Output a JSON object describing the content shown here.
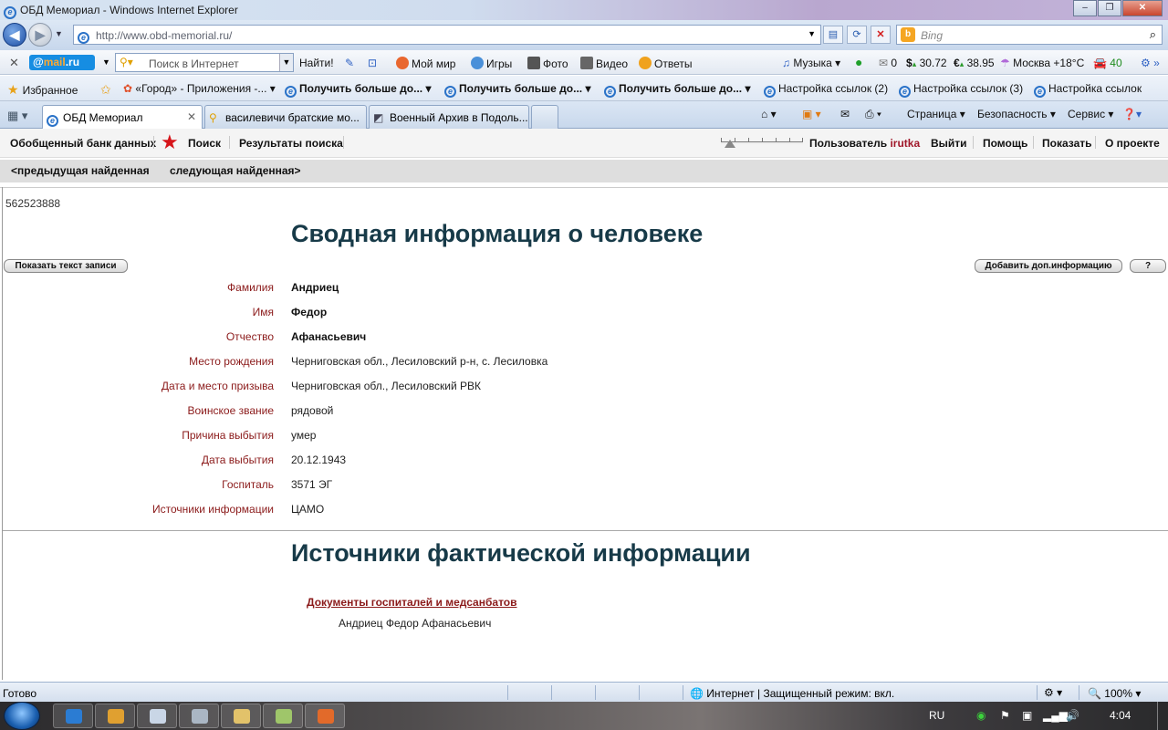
{
  "window": {
    "title": "ОБД Мемориал - Windows Internet Explorer"
  },
  "address": {
    "url": "http://www.obd-memorial.ru/",
    "search_placeholder": "Bing"
  },
  "mailru": {
    "logo": "@mail.ru",
    "search_placeholder": "Поиск в Интернет",
    "find": "Найти!",
    "items": [
      "Мой мир",
      "Игры",
      "Фото",
      "Видео",
      "Ответы"
    ],
    "music": "Музыка",
    "mail_count": "0",
    "usd": "30.72",
    "eur": "38.95",
    "weather": "Москва +18°C",
    "traffic": "40"
  },
  "favorites": {
    "label": "Избранное",
    "items": [
      "«Город» - Приложения -...",
      "Получить больше до...",
      "Получить больше до...",
      "Получить больше до...",
      "Настройка ссылок (2)",
      "Настройка ссылок (3)",
      "Настройка ссылок"
    ]
  },
  "tabs": [
    {
      "label": "ОБД Мемориал"
    },
    {
      "label": "василевичи братские мо..."
    },
    {
      "label": "Военный Архив в Подоль..."
    }
  ],
  "commands": {
    "page": "Страница",
    "security": "Безопасность",
    "service": "Сервис"
  },
  "site_nav": {
    "bank": "Обобщенный банк данных",
    "search": "Поиск",
    "results": "Результаты поиска",
    "user_label": "Пользователь",
    "user_name": "irutka",
    "logout": "Выйти",
    "help": "Помощь",
    "show": "Показать",
    "about": "О проекте"
  },
  "record_nav": {
    "prev": "<предыдущая найденная",
    "next": "следующая найденная>"
  },
  "record": {
    "id": "562523888",
    "title": "Сводная информация о человеке",
    "show_text_btn": "Показать текст записи",
    "add_info_btn": "Добавить доп.информацию",
    "help_btn": "?",
    "fields": [
      {
        "label": "Фамилия",
        "value": "Андриец",
        "bold": true
      },
      {
        "label": "Имя",
        "value": "Федор",
        "bold": true
      },
      {
        "label": "Отчество",
        "value": "Афанасьевич",
        "bold": true
      },
      {
        "label": "Место рождения",
        "value": "Черниговская обл., Лесиловский р-н, с. Лесиловка"
      },
      {
        "label": "Дата и место призыва",
        "value": "Черниговская обл., Лесиловский РВК"
      },
      {
        "label": "Воинское звание",
        "value": "рядовой"
      },
      {
        "label": "Причина выбытия",
        "value": "умер"
      },
      {
        "label": "Дата выбытия",
        "value": "20.12.1943"
      },
      {
        "label": "Госпиталь",
        "value": "3571 ЭГ"
      },
      {
        "label": "Источники информации",
        "value": "ЦАМО"
      }
    ]
  },
  "sources": {
    "title": "Источники фактической информации",
    "doc_link": "Документы госпиталей и медсанбатов",
    "doc_name": "Андриец Федор Афанасьевич"
  },
  "status": {
    "left": "Готово",
    "zone": "Интернет | Защищенный режим: вкл.",
    "zoom": "100%"
  },
  "tray": {
    "lang": "RU",
    "time": "4:04"
  }
}
